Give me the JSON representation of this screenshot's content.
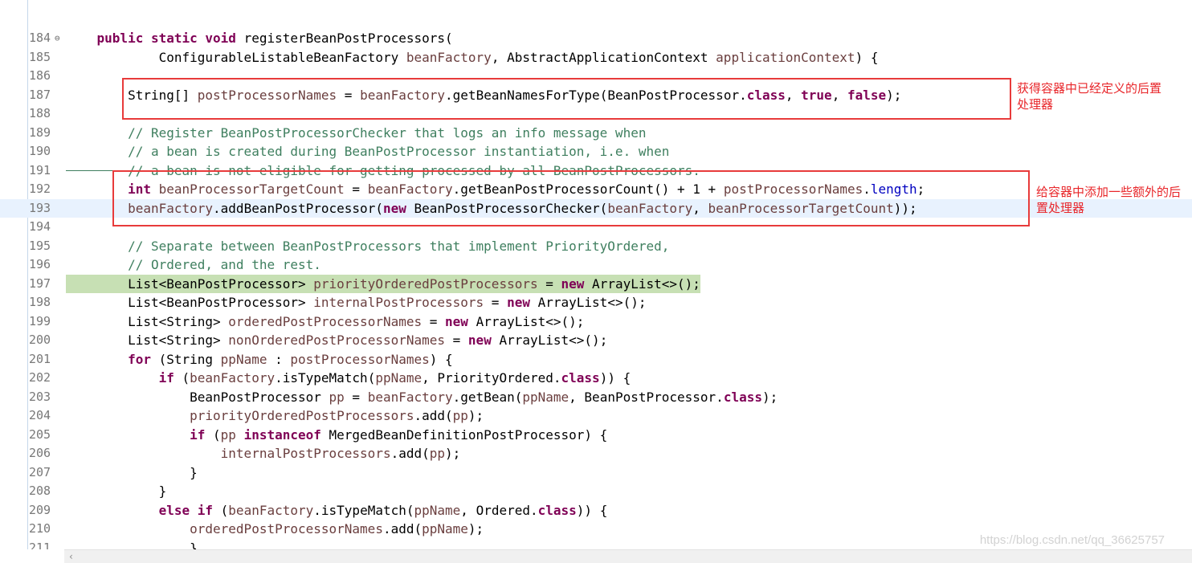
{
  "editor": {
    "lines": [
      {
        "n": "184",
        "fold": true,
        "tokens": [
          [
            "p",
            "    "
          ],
          [
            "kw",
            "public"
          ],
          [
            "p",
            " "
          ],
          [
            "kw",
            "static"
          ],
          [
            "p",
            " "
          ],
          [
            "kw",
            "void"
          ],
          [
            "p",
            " registerBeanPostProcessors("
          ]
        ]
      },
      {
        "n": "185",
        "tokens": [
          [
            "p",
            "            ConfigurableListableBeanFactory "
          ],
          [
            "var",
            "beanFactory"
          ],
          [
            "p",
            ", AbstractApplicationContext "
          ],
          [
            "var",
            "applicationContext"
          ],
          [
            "p",
            ") {"
          ]
        ]
      },
      {
        "n": "186",
        "tokens": []
      },
      {
        "n": "187",
        "tokens": [
          [
            "p",
            "        String[] "
          ],
          [
            "var",
            "postProcessorNames"
          ],
          [
            "p",
            " = "
          ],
          [
            "var",
            "beanFactory"
          ],
          [
            "p",
            ".getBeanNamesForType(BeanPostProcessor."
          ],
          [
            "kw",
            "class"
          ],
          [
            "p",
            ", "
          ],
          [
            "kw",
            "true"
          ],
          [
            "p",
            ", "
          ],
          [
            "kw",
            "false"
          ],
          [
            "p",
            ");"
          ]
        ]
      },
      {
        "n": "188",
        "tokens": []
      },
      {
        "n": "189",
        "tokens": [
          [
            "cmt",
            "        // Register BeanPostProcessorChecker that logs an info message when"
          ]
        ]
      },
      {
        "n": "190",
        "tokens": [
          [
            "cmt",
            "        // a bean is created during BeanPostProcessor instantiation, i.e. when"
          ]
        ]
      },
      {
        "n": "191",
        "tokens": [
          [
            "cmt",
            "        // a bean is not eligible for getting processed by all BeanPostProcessors."
          ]
        ]
      },
      {
        "n": "192",
        "tokens": [
          [
            "p",
            "        "
          ],
          [
            "kw",
            "int"
          ],
          [
            "p",
            " "
          ],
          [
            "var",
            "beanProcessorTargetCount"
          ],
          [
            "p",
            " = "
          ],
          [
            "var",
            "beanFactory"
          ],
          [
            "p",
            ".getBeanPostProcessorCount() + 1 + "
          ],
          [
            "var",
            "postProcessorNames"
          ],
          [
            "p",
            "."
          ],
          [
            "fld",
            "length"
          ],
          [
            "p",
            ";"
          ]
        ]
      },
      {
        "n": "193",
        "current": true,
        "tokens": [
          [
            "p",
            "        "
          ],
          [
            "var",
            "beanFactory"
          ],
          [
            "p",
            ".addBeanPostProcessor("
          ],
          [
            "kw",
            "new"
          ],
          [
            "p",
            " BeanPostProcessorChecker("
          ],
          [
            "var",
            "beanFactory"
          ],
          [
            "p",
            ", "
          ],
          [
            "var",
            "beanProcessorTargetCount"
          ],
          [
            "p",
            "));"
          ]
        ]
      },
      {
        "n": "194",
        "tokens": []
      },
      {
        "n": "195",
        "tokens": [
          [
            "cmt",
            "        // Separate between BeanPostProcessors that implement PriorityOrdered,"
          ]
        ]
      },
      {
        "n": "196",
        "tokens": [
          [
            "cmt",
            "        // Ordered, and the rest."
          ]
        ]
      },
      {
        "n": "197",
        "highlight": true,
        "tokens": [
          [
            "p",
            "        List<BeanPostProcessor> "
          ],
          [
            "var",
            "priorityOrderedPostProcessors"
          ],
          [
            "p",
            " = "
          ],
          [
            "kw",
            "new"
          ],
          [
            "p",
            " ArrayList<>();"
          ]
        ]
      },
      {
        "n": "198",
        "tokens": [
          [
            "p",
            "        List<BeanPostProcessor> "
          ],
          [
            "var",
            "internalPostProcessors"
          ],
          [
            "p",
            " = "
          ],
          [
            "kw",
            "new"
          ],
          [
            "p",
            " ArrayList<>();"
          ]
        ]
      },
      {
        "n": "199",
        "tokens": [
          [
            "p",
            "        List<String> "
          ],
          [
            "var",
            "orderedPostProcessorNames"
          ],
          [
            "p",
            " = "
          ],
          [
            "kw",
            "new"
          ],
          [
            "p",
            " ArrayList<>();"
          ]
        ]
      },
      {
        "n": "200",
        "tokens": [
          [
            "p",
            "        List<String> "
          ],
          [
            "var",
            "nonOrderedPostProcessorNames"
          ],
          [
            "p",
            " = "
          ],
          [
            "kw",
            "new"
          ],
          [
            "p",
            " ArrayList<>();"
          ]
        ]
      },
      {
        "n": "201",
        "tokens": [
          [
            "p",
            "        "
          ],
          [
            "kw",
            "for"
          ],
          [
            "p",
            " (String "
          ],
          [
            "var",
            "ppName"
          ],
          [
            "p",
            " : "
          ],
          [
            "var",
            "postProcessorNames"
          ],
          [
            "p",
            ") {"
          ]
        ]
      },
      {
        "n": "202",
        "tokens": [
          [
            "p",
            "            "
          ],
          [
            "kw",
            "if"
          ],
          [
            "p",
            " ("
          ],
          [
            "var",
            "beanFactory"
          ],
          [
            "p",
            ".isTypeMatch("
          ],
          [
            "var",
            "ppName"
          ],
          [
            "p",
            ", PriorityOrdered."
          ],
          [
            "kw",
            "class"
          ],
          [
            "p",
            ")) {"
          ]
        ]
      },
      {
        "n": "203",
        "tokens": [
          [
            "p",
            "                BeanPostProcessor "
          ],
          [
            "var",
            "pp"
          ],
          [
            "p",
            " = "
          ],
          [
            "var",
            "beanFactory"
          ],
          [
            "p",
            ".getBean("
          ],
          [
            "var",
            "ppName"
          ],
          [
            "p",
            ", BeanPostProcessor."
          ],
          [
            "kw",
            "class"
          ],
          [
            "p",
            ");"
          ]
        ]
      },
      {
        "n": "204",
        "tokens": [
          [
            "p",
            "                "
          ],
          [
            "var",
            "priorityOrderedPostProcessors"
          ],
          [
            "p",
            ".add("
          ],
          [
            "var",
            "pp"
          ],
          [
            "p",
            ");"
          ]
        ]
      },
      {
        "n": "205",
        "tokens": [
          [
            "p",
            "                "
          ],
          [
            "kw",
            "if"
          ],
          [
            "p",
            " ("
          ],
          [
            "var",
            "pp"
          ],
          [
            "p",
            " "
          ],
          [
            "kw",
            "instanceof"
          ],
          [
            "p",
            " MergedBeanDefinitionPostProcessor) {"
          ]
        ]
      },
      {
        "n": "206",
        "tokens": [
          [
            "p",
            "                    "
          ],
          [
            "var",
            "internalPostProcessors"
          ],
          [
            "p",
            ".add("
          ],
          [
            "var",
            "pp"
          ],
          [
            "p",
            ");"
          ]
        ]
      },
      {
        "n": "207",
        "tokens": [
          [
            "p",
            "                }"
          ]
        ]
      },
      {
        "n": "208",
        "tokens": [
          [
            "p",
            "            }"
          ]
        ]
      },
      {
        "n": "209",
        "tokens": [
          [
            "p",
            "            "
          ],
          [
            "kw",
            "else"
          ],
          [
            "p",
            " "
          ],
          [
            "kw",
            "if"
          ],
          [
            "p",
            " ("
          ],
          [
            "var",
            "beanFactory"
          ],
          [
            "p",
            ".isTypeMatch("
          ],
          [
            "var",
            "ppName"
          ],
          [
            "p",
            ", Ordered."
          ],
          [
            "kw",
            "class"
          ],
          [
            "p",
            ")) {"
          ]
        ]
      },
      {
        "n": "210",
        "tokens": [
          [
            "p",
            "                "
          ],
          [
            "var",
            "orderedPostProcessorNames"
          ],
          [
            "p",
            ".add("
          ],
          [
            "var",
            "ppName"
          ],
          [
            "p",
            ");"
          ]
        ]
      },
      {
        "n": "211",
        "tokens": [
          [
            "p",
            "                }"
          ]
        ]
      }
    ]
  },
  "annotations": {
    "note1": "获得容器中已经定义的后置处理器",
    "note2": "给容器中添加一些额外的后置处理器"
  },
  "watermark": "https://blog.csdn.net/qq_36625757",
  "scrollbar": {
    "left_arrow": "‹"
  }
}
